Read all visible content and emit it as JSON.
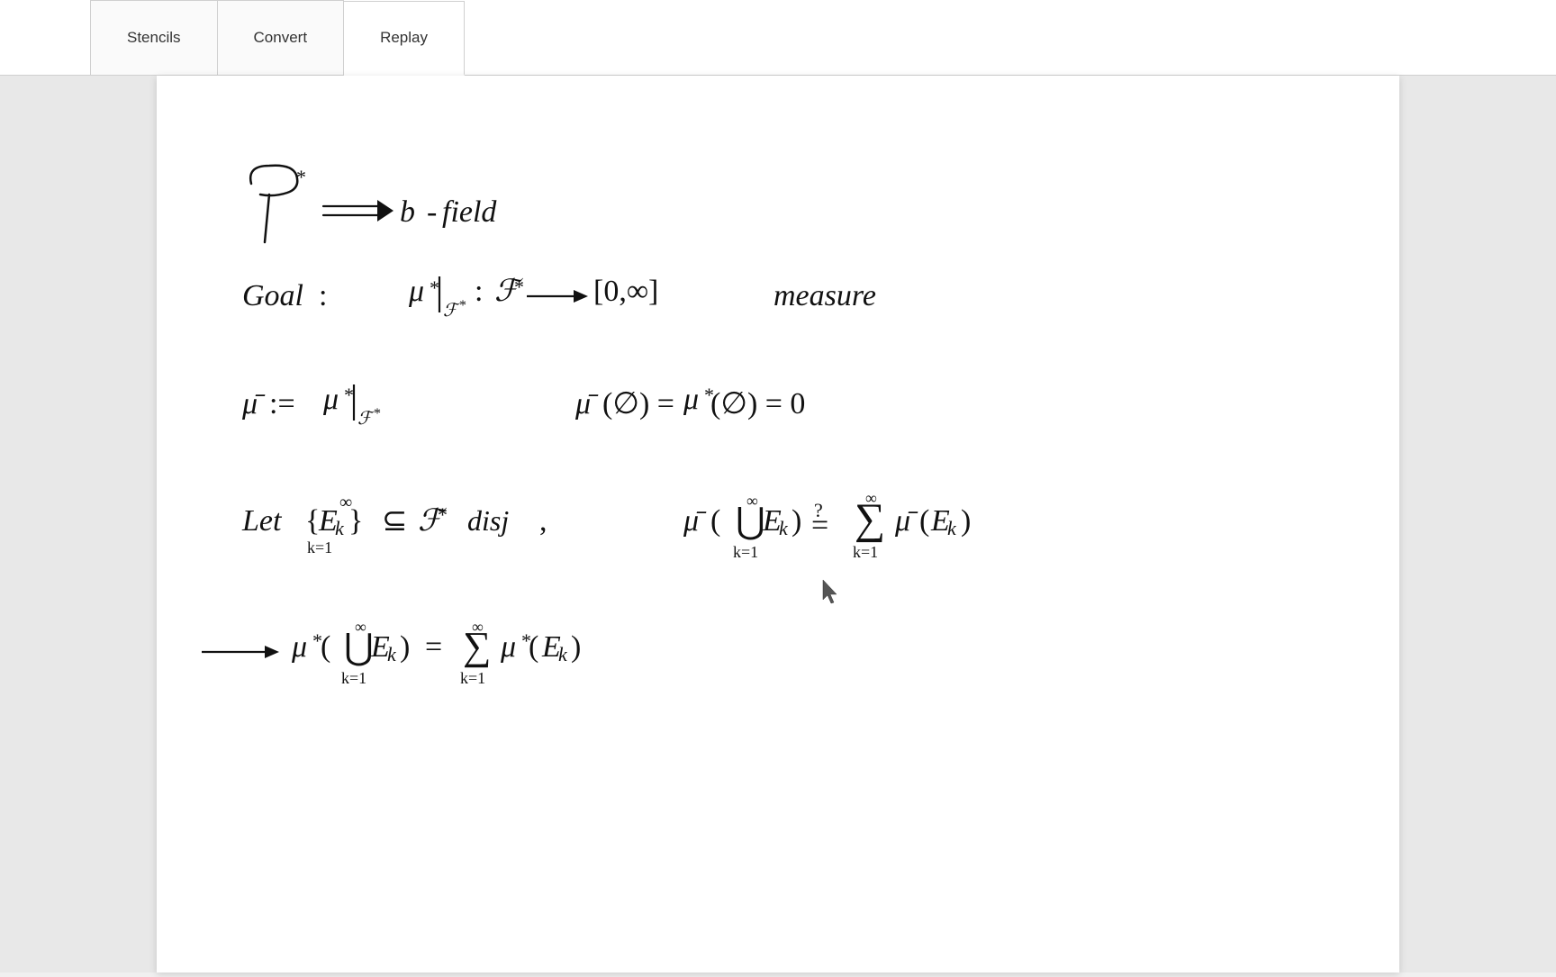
{
  "toolbar": {
    "tabs": [
      {
        "id": "stencils",
        "label": "Stencils",
        "active": false
      },
      {
        "id": "convert",
        "label": "Convert",
        "active": false
      },
      {
        "id": "replay",
        "label": "Replay",
        "active": false
      }
    ]
  },
  "canvas": {
    "background": "#ffffff",
    "content_description": "Handwritten math notes about measure theory"
  }
}
